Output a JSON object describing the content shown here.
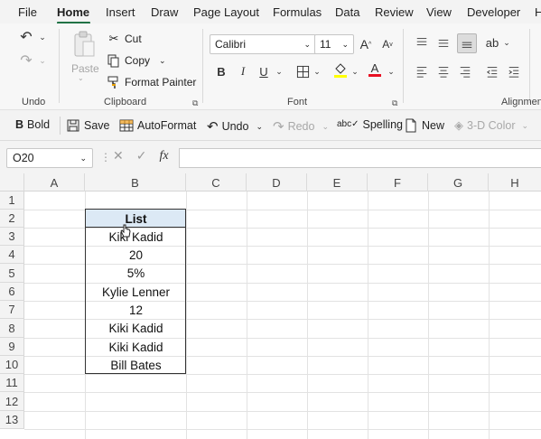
{
  "menu": {
    "items": [
      "File",
      "Home",
      "Insert",
      "Draw",
      "Page Layout",
      "Formulas",
      "Data",
      "Review",
      "View",
      "Developer",
      "H"
    ]
  },
  "ribbon": {
    "undo_group_label": "Undo",
    "clipboard": {
      "paste": "Paste",
      "cut": "Cut",
      "copy": "Copy",
      "format_painter": "Format Painter",
      "label": "Clipboard"
    },
    "font": {
      "name": "Calibri",
      "size": "11",
      "label": "Font",
      "bold": "B",
      "italic": "I",
      "underline": "U",
      "grow": "A",
      "shrink": "A",
      "font_color": "A",
      "font_color_hex": "#e81123",
      "fill_color_hex": "#ffff00"
    },
    "alignment_label": "Alignmen"
  },
  "qat": {
    "bold": "Bold",
    "save": "Save",
    "autoformat": "AutoFormat",
    "undo": "Undo",
    "redo": "Redo",
    "spelling": "Spelling",
    "new": "New",
    "three_d_color": "3-D Color"
  },
  "formula_bar": {
    "name_box": "O20",
    "fx": "fx",
    "cancel": "✕",
    "enter": "✓",
    "value": ""
  },
  "grid": {
    "columns": [
      "A",
      "B",
      "C",
      "D",
      "E",
      "F",
      "G",
      "H"
    ],
    "rows": [
      "1",
      "2",
      "3",
      "4",
      "5",
      "6",
      "7",
      "8",
      "9",
      "10",
      "11",
      "12",
      "13"
    ],
    "list": {
      "header": "List",
      "header_fill": "#dce9f5",
      "values": [
        "Kiki Kadid",
        "20",
        "5%",
        "Kylie Lenner",
        "12",
        "Kiki Kadid",
        "Kiki Kadid",
        "Bill Bates"
      ]
    }
  }
}
